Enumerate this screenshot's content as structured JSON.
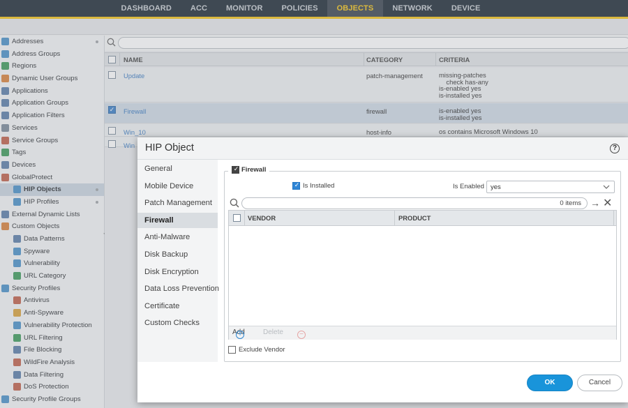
{
  "nav": {
    "tabs": [
      "DASHBOARD",
      "ACC",
      "MONITOR",
      "POLICIES",
      "OBJECTS",
      "NETWORK",
      "DEVICE"
    ],
    "active_tab": "OBJECTS"
  },
  "sidebar": {
    "items": [
      {
        "label": "Addresses",
        "icon": "address-icon",
        "color": "#4a90c8",
        "level": 0,
        "dot": true
      },
      {
        "label": "Address Groups",
        "icon": "address-group-icon",
        "color": "#4a90c8",
        "level": 0
      },
      {
        "label": "Regions",
        "icon": "globe-icon",
        "color": "#3d9a5b",
        "level": 0
      },
      {
        "label": "Dynamic User Groups",
        "icon": "user-group-icon",
        "color": "#d9813b",
        "level": 0
      },
      {
        "label": "Applications",
        "icon": "applications-icon",
        "color": "#5a7da8",
        "level": 0
      },
      {
        "label": "Application Groups",
        "icon": "application-group-icon",
        "color": "#5a7da8",
        "level": 0
      },
      {
        "label": "Application Filters",
        "icon": "application-filter-icon",
        "color": "#5a7da8",
        "level": 0
      },
      {
        "label": "Services",
        "icon": "services-icon",
        "color": "#7a8a99",
        "level": 0
      },
      {
        "label": "Service Groups",
        "icon": "service-group-icon",
        "color": "#c0604a",
        "level": 0
      },
      {
        "label": "Tags",
        "icon": "tag-icon",
        "color": "#3d9a5b",
        "level": 0
      },
      {
        "label": "Devices",
        "icon": "devices-icon",
        "color": "#5a7da8",
        "level": 0
      },
      {
        "label": "GlobalProtect",
        "icon": "globalprotect-icon",
        "color": "#c0604a",
        "level": 0
      },
      {
        "label": "HIP Objects",
        "icon": "hip-object-icon",
        "color": "#4a90c8",
        "level": 1,
        "selected": true,
        "dot": true
      },
      {
        "label": "HIP Profiles",
        "icon": "hip-profile-icon",
        "color": "#4a90c8",
        "level": 1,
        "dot": true
      },
      {
        "label": "External Dynamic Lists",
        "icon": "external-list-icon",
        "color": "#5a7da8",
        "level": 0
      },
      {
        "label": "Custom Objects",
        "icon": "custom-objects-icon",
        "color": "#d9813b",
        "level": 0
      },
      {
        "label": "Data Patterns",
        "icon": "data-pattern-icon",
        "color": "#5a7da8",
        "level": 1
      },
      {
        "label": "Spyware",
        "icon": "spyware-icon",
        "color": "#4a90c8",
        "level": 1
      },
      {
        "label": "Vulnerability",
        "icon": "vulnerability-icon",
        "color": "#4a90c8",
        "level": 1
      },
      {
        "label": "URL Category",
        "icon": "url-category-icon",
        "color": "#3d9a5b",
        "level": 1
      },
      {
        "label": "Security Profiles",
        "icon": "security-profiles-icon",
        "color": "#4a90c8",
        "level": 0
      },
      {
        "label": "Antivirus",
        "icon": "antivirus-icon",
        "color": "#c0604a",
        "level": 1
      },
      {
        "label": "Anti-Spyware",
        "icon": "anti-spyware-icon",
        "color": "#d9a13b",
        "level": 1
      },
      {
        "label": "Vulnerability Protection",
        "icon": "vulnerability-protection-icon",
        "color": "#4a90c8",
        "level": 1
      },
      {
        "label": "URL Filtering",
        "icon": "url-filtering-icon",
        "color": "#3d9a5b",
        "level": 1
      },
      {
        "label": "File Blocking",
        "icon": "file-blocking-icon",
        "color": "#5a7da8",
        "level": 1
      },
      {
        "label": "WildFire Analysis",
        "icon": "wildfire-icon",
        "color": "#c0604a",
        "level": 1
      },
      {
        "label": "Data Filtering",
        "icon": "data-filtering-icon",
        "color": "#5a7da8",
        "level": 1
      },
      {
        "label": "DoS Protection",
        "icon": "dos-protection-icon",
        "color": "#c0604a",
        "level": 1
      },
      {
        "label": "Security Profile Groups",
        "icon": "profile-groups-icon",
        "color": "#4a90c8",
        "level": 0
      }
    ]
  },
  "grid": {
    "headers": {
      "name": "NAME",
      "category": "CATEGORY",
      "criteria": "CRITERIA"
    },
    "rows": [
      {
        "name": "Update",
        "category": "patch-management",
        "criteria": [
          "missing-patches",
          "    check has-any",
          "is-enabled yes",
          "is-installed yes"
        ],
        "checked": false
      },
      {
        "name": "Firewall",
        "category": "firewall",
        "criteria": [
          "is-enabled yes",
          "is-installed yes"
        ],
        "checked": true
      },
      {
        "name": "Win_10",
        "category": "host-info",
        "criteria": [
          "os contains Microsoft Windows 10"
        ],
        "checked": false
      },
      {
        "name": "Win",
        "category": "",
        "criteria": [],
        "checked": false
      }
    ]
  },
  "modal": {
    "title": "HIP Object",
    "help_icon": "?",
    "nav": [
      "General",
      "Mobile Device",
      "Patch Management",
      "Firewall",
      "Anti-Malware",
      "Disk Backup",
      "Disk Encryption",
      "Data Loss Prevention",
      "Certificate",
      "Custom Checks"
    ],
    "active_nav": "Firewall",
    "section_label": "Firewall",
    "is_installed_label": "Is Installed",
    "is_enabled_label": "Is Enabled",
    "is_enabled_value": "yes",
    "items_count": "0 items",
    "table_headers": {
      "vendor": "VENDOR",
      "product": "PRODUCT"
    },
    "add_label": "Add",
    "delete_label": "Delete",
    "exclude_vendor_label": "Exclude Vendor",
    "ok_label": "OK",
    "cancel_label": "Cancel"
  },
  "colors": {
    "accent": "#f5c518",
    "primary_button": "#1994da",
    "link": "#3a7ac0"
  }
}
